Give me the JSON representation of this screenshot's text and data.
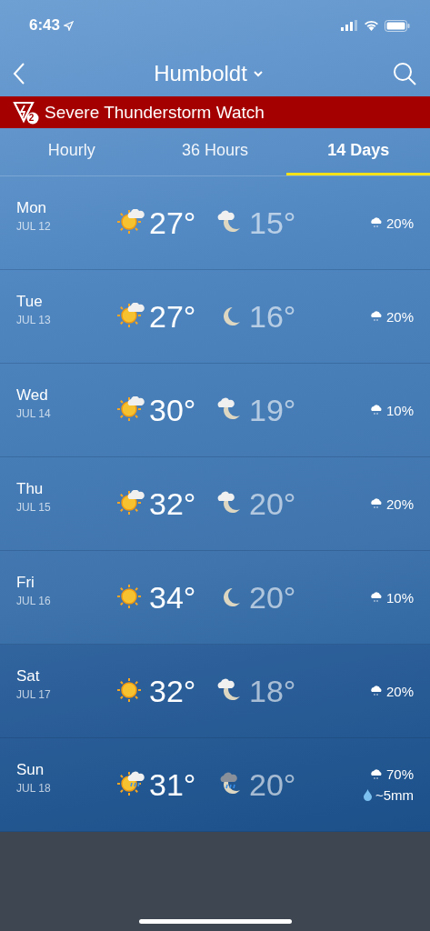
{
  "status_bar": {
    "time": "6:43"
  },
  "header": {
    "location": "Humboldt"
  },
  "alert": {
    "text": "Severe Thunderstorm Watch",
    "count": "2"
  },
  "tabs": [
    {
      "label": "Hourly",
      "selected": false
    },
    {
      "label": "36 Hours",
      "selected": false
    },
    {
      "label": "14 Days",
      "selected": true
    }
  ],
  "days": [
    {
      "day": "Mon",
      "date": "JUL 12",
      "high": {
        "kind": "sun-cloud",
        "temp": "27°"
      },
      "low": {
        "kind": "moon-cloud",
        "temp": "15°"
      },
      "precip": "20%"
    },
    {
      "day": "Tue",
      "date": "JUL 13",
      "high": {
        "kind": "sun-cloud",
        "temp": "27°"
      },
      "low": {
        "kind": "moon",
        "temp": "16°"
      },
      "precip": "20%"
    },
    {
      "day": "Wed",
      "date": "JUL 14",
      "high": {
        "kind": "sun-cloud",
        "temp": "30°"
      },
      "low": {
        "kind": "moon-cloud",
        "temp": "19°"
      },
      "precip": "10%"
    },
    {
      "day": "Thu",
      "date": "JUL 15",
      "high": {
        "kind": "sun-cloud",
        "temp": "32°"
      },
      "low": {
        "kind": "moon-cloud",
        "temp": "20°"
      },
      "precip": "20%"
    },
    {
      "day": "Fri",
      "date": "JUL 16",
      "high": {
        "kind": "sun",
        "temp": "34°"
      },
      "low": {
        "kind": "moon",
        "temp": "20°"
      },
      "precip": "10%"
    },
    {
      "day": "Sat",
      "date": "JUL 17",
      "high": {
        "kind": "sun",
        "temp": "32°"
      },
      "low": {
        "kind": "moon-cloud",
        "temp": "18°"
      },
      "precip": "20%"
    },
    {
      "day": "Sun",
      "date": "JUL 18",
      "high": {
        "kind": "sun-cloud-rain",
        "temp": "31°"
      },
      "low": {
        "kind": "moon-cloud-rain",
        "temp": "20°"
      },
      "precip": "70%",
      "amount": "~5mm"
    }
  ]
}
